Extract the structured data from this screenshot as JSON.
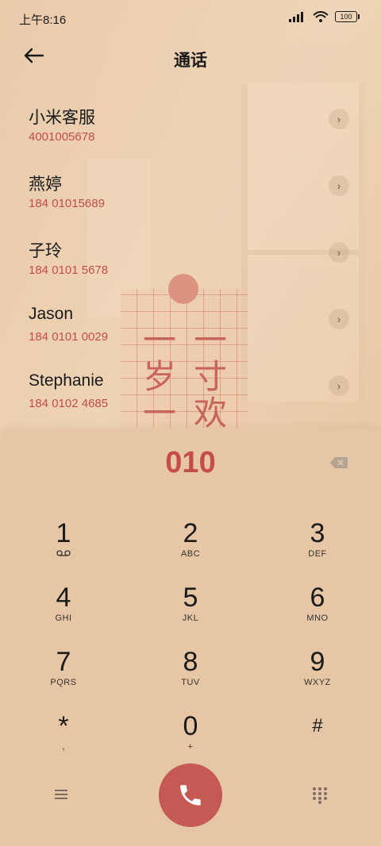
{
  "status_bar": {
    "time": "上午8:16",
    "battery": "100"
  },
  "header": {
    "title": "通话"
  },
  "contacts": [
    {
      "name": "小米客服",
      "number": "4001005678"
    },
    {
      "name": "燕婷",
      "number": "184 01015689"
    },
    {
      "name": "子玲",
      "number": "184 0101 5678"
    },
    {
      "name": "Jason",
      "number": "184 0101 0029"
    },
    {
      "name": "Stephanie",
      "number": "184 0102 4685"
    }
  ],
  "card_text": {
    "col1": "一岁一礼",
    "col2": "一寸欢喜"
  },
  "dialer": {
    "input": "010",
    "keys": [
      {
        "digit": "1",
        "letters": ""
      },
      {
        "digit": "2",
        "letters": "ABC"
      },
      {
        "digit": "3",
        "letters": "DEF"
      },
      {
        "digit": "4",
        "letters": "GHI"
      },
      {
        "digit": "5",
        "letters": "JKL"
      },
      {
        "digit": "6",
        "letters": "MNO"
      },
      {
        "digit": "7",
        "letters": "PQRS"
      },
      {
        "digit": "8",
        "letters": "TUV"
      },
      {
        "digit": "9",
        "letters": "WXYZ"
      },
      {
        "digit": "*",
        "letters": ","
      },
      {
        "digit": "0",
        "letters": "+"
      },
      {
        "digit": "#",
        "letters": ""
      }
    ]
  },
  "colors": {
    "accent": "#c44d49",
    "call_button": "#c55a55",
    "background": "#e6c6a4"
  }
}
